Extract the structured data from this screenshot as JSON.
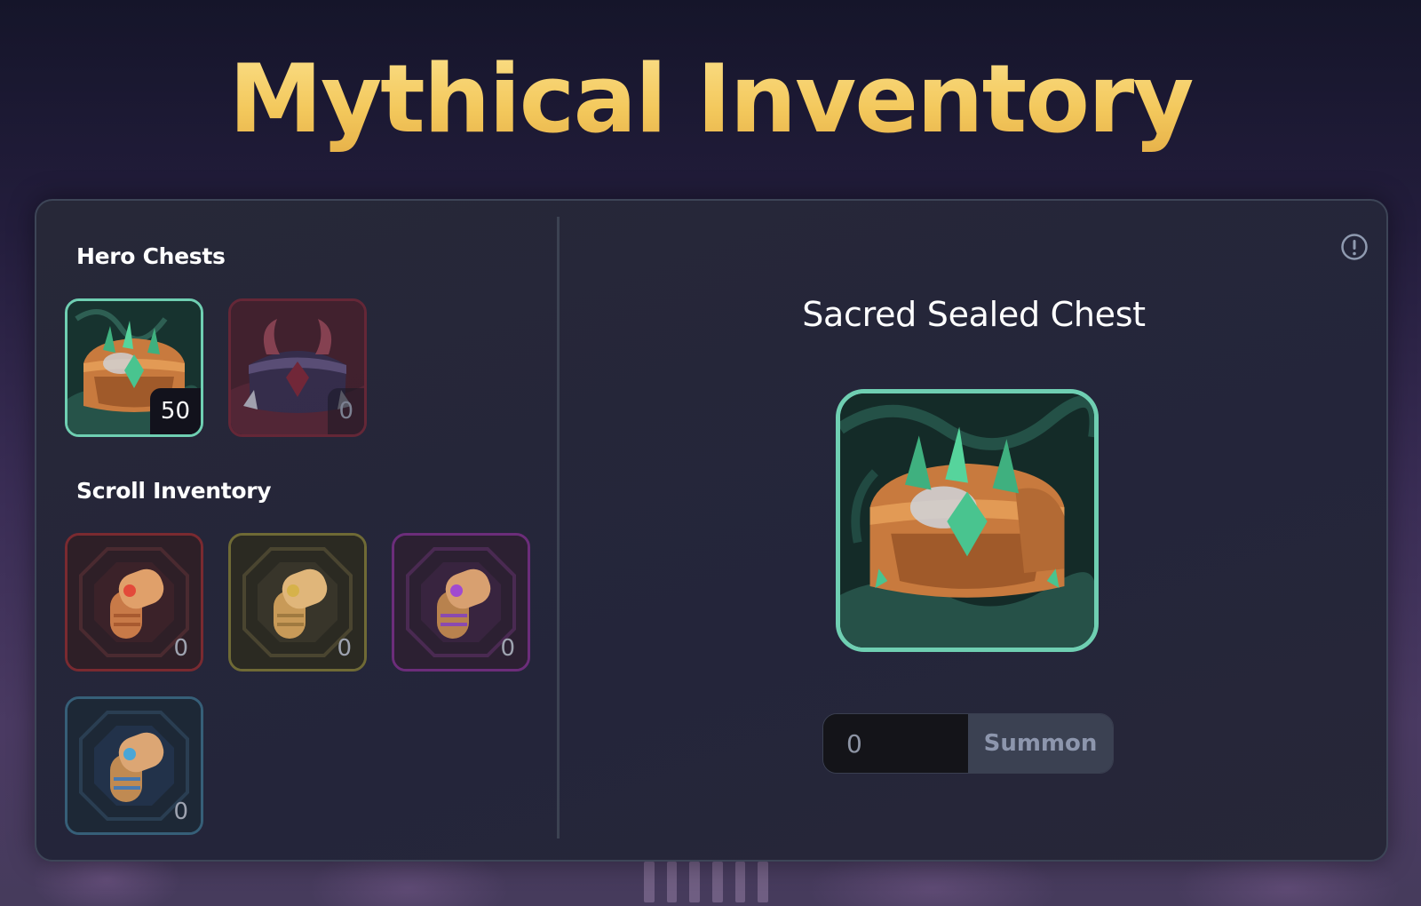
{
  "page": {
    "title": "Mythical Inventory"
  },
  "left_panel": {
    "hero_chests_title": "Hero Chests",
    "hero_chests": [
      {
        "name": "Sacred Sealed Chest",
        "count": "50",
        "selected": true
      },
      {
        "name": "Dark chest",
        "count": "0",
        "selected": false
      }
    ],
    "scroll_inventory_title": "Scroll Inventory",
    "scrolls": [
      {
        "color": "red",
        "count": "0"
      },
      {
        "color": "gold",
        "count": "0"
      },
      {
        "color": "purple",
        "count": "0"
      },
      {
        "color": "blue",
        "count": "0"
      }
    ]
  },
  "detail": {
    "title": "Sacred Sealed Chest",
    "info_icon": "info-icon"
  },
  "summon": {
    "placeholder": "0",
    "value": "",
    "button_label": "Summon"
  },
  "colors": {
    "title_gold": "#f3cf6a",
    "selected_border": "#6fcfb2",
    "panel_bg": "#262737",
    "summon_button_bg": "#3b4152"
  }
}
